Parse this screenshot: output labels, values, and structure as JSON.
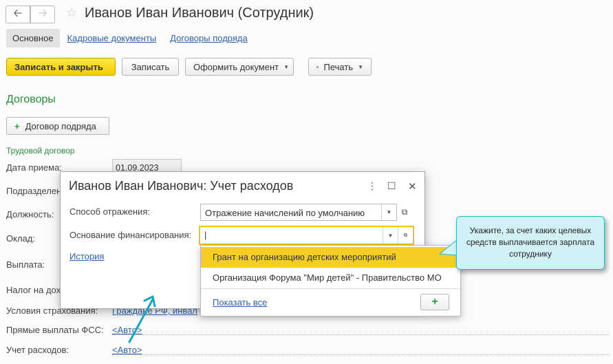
{
  "header": {
    "back_icon": "arrow-left-icon",
    "forward_icon": "arrow-right-icon",
    "star_icon": "star-icon",
    "title": "Иванов Иван Иванович (Сотрудник)"
  },
  "tabs": [
    {
      "label": "Основное",
      "active": true
    },
    {
      "label": "Кадровые документы",
      "active": false
    },
    {
      "label": "Договоры подряда",
      "active": false
    }
  ],
  "toolbar": {
    "save_close": "Записать и закрыть",
    "save": "Записать",
    "create_doc": "Оформить документ",
    "print": "Печать",
    "print_icon": "printer-icon"
  },
  "contracts": {
    "section_title": "Договоры",
    "add_contract": "Договор подряда"
  },
  "employment": {
    "group_title": "Трудовой договор",
    "hire_date_label": "Дата приема:",
    "hire_date": "01.09.2023",
    "department_label": "Подразделен",
    "position_label": "Должность:",
    "salary_label": "Оклад:",
    "payment_label": "Выплата:",
    "tax_label": "Налог на дох",
    "insurance_label": "Условия страхования:",
    "insurance_value": "Граждане РФ, инвал",
    "fss_label": "Прямые выплаты ФСС:",
    "fss_value": "<Авто>",
    "expense_label": "Учет расходов:",
    "expense_value": "<Авто>"
  },
  "dialog": {
    "title": "Иванов Иван Иванович: Учет расходов",
    "method_label": "Способ отражения:",
    "method_value": "Отражение начислений по умолчанию",
    "funding_label": "Основание финансирования:",
    "funding_value": "|",
    "history_link": "История"
  },
  "dropdown": {
    "options": [
      "Грант на организацию детских мероприятий",
      "Организация Форума \"Мир детей\" - Правительство МО"
    ],
    "selected_index": 0,
    "show_all": "Показать все"
  },
  "tooltip": {
    "text": "Укажите, за счет каких целевых средств выплачивается зарплата сотруднику"
  },
  "colors": {
    "accent_yellow": "#f5ce25",
    "group_green": "#2c8a3e",
    "link_blue": "#2d63a8",
    "tooltip_bg": "#d2f1f7",
    "arrow": "#1aa5bf"
  }
}
